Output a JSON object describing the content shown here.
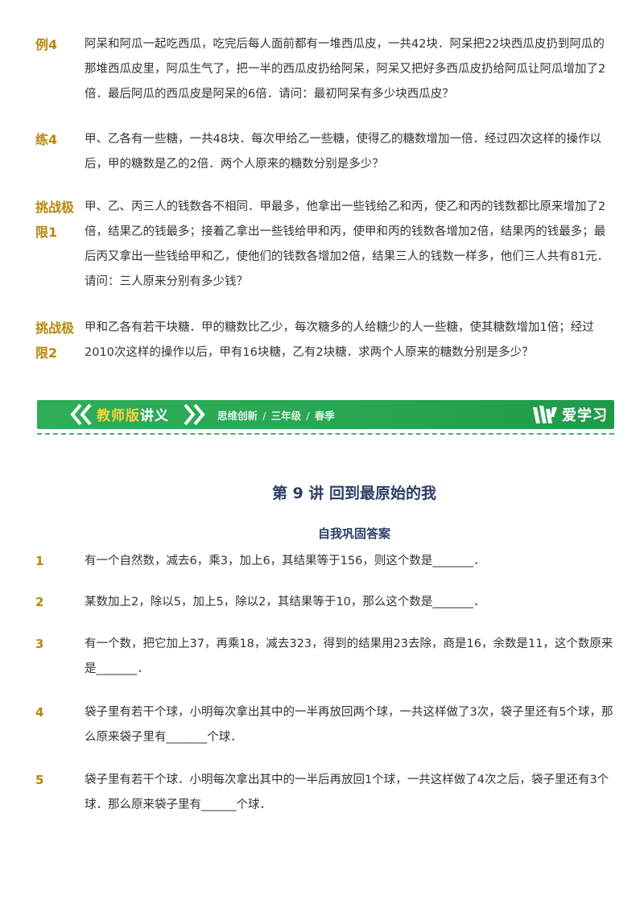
{
  "problems": [
    {
      "label": "例4",
      "text": "阿呆和阿瓜一起吃西瓜，吃完后每人面前都有一堆西瓜皮，一共42块．阿呆把22块西瓜皮扔到阿瓜的那堆西瓜皮里，阿瓜生气了，把一半的西瓜皮扔给阿呆，阿呆又把好多西瓜皮扔给阿瓜让阿瓜增加了2倍．最后阿瓜的西瓜皮是阿呆的6倍．请问：最初阿呆有多少块西瓜皮？"
    },
    {
      "label": "练4",
      "text": "甲、乙各有一些糖，一共48块．每次甲给乙一些糖，使得乙的糖数增加一倍．经过四次这样的操作以后，甲的糖数是乙的2倍．两个人原来的糖数分别是多少？"
    },
    {
      "label": "挑战极限1",
      "text": "甲、乙、丙三人的钱数各不相同．甲最多，他拿出一些钱给乙和丙，使乙和丙的钱数都比原来增加了2倍，结果乙的钱最多；接着乙拿出一些钱给甲和丙，使甲和丙的钱数各增加2倍，结果丙的钱最多；最后丙又拿出一些钱给甲和乙，使他们的钱数各增加2倍，结果三人的钱数一样多，他们三人共有81元．请问：三人原来分别有多少钱？"
    },
    {
      "label": "挑战极限2",
      "text": "甲和乙各有若干块糖．甲的糖数比乙少，每次糖多的人给糖少的人一些糖，使其糖数增加1倍；经过2010次这样的操作以后，甲有16块糖，乙有2块糖．求两个人原来的糖数分别是多少？"
    }
  ],
  "banner": {
    "title_a": "教师版",
    "title_b": "讲义",
    "tags": [
      "思维创新",
      "三年级",
      "春季"
    ],
    "logo_text": "爱学习"
  },
  "lecture_title": "第 9 讲   回到最原始的我",
  "section_title": "自我巩固答案",
  "questions": [
    {
      "num": "1",
      "text": "有一个自然数，减去6，乘3，加上6，其结果等于156，则这个数是_______．"
    },
    {
      "num": "2",
      "text": "某数加上2，除以5，加上5，除以2，其结果等于10，那么这个数是_______．"
    },
    {
      "num": "3",
      "text": "有一个数，把它加上37，再乘18，减去323，得到的结果用23去除，商是16，余数是11，这个数原来是_______．"
    },
    {
      "num": "4",
      "text": "袋子里有若干个球，小明每次拿出其中的一半再放回两个球，一共这样做了3次，袋子里还有5个球，那么原来袋子里有_______个球．"
    },
    {
      "num": "5",
      "text": "袋子里有若干个球．小明每次拿出其中的一半后再放回1个球，一共这样做了4次之后，袋子里还有3个球．那么原来袋子里有______个球．"
    }
  ],
  "colors": {
    "label": "#b8860b",
    "banner": "#2fae5a",
    "title": "#2c3e66"
  }
}
